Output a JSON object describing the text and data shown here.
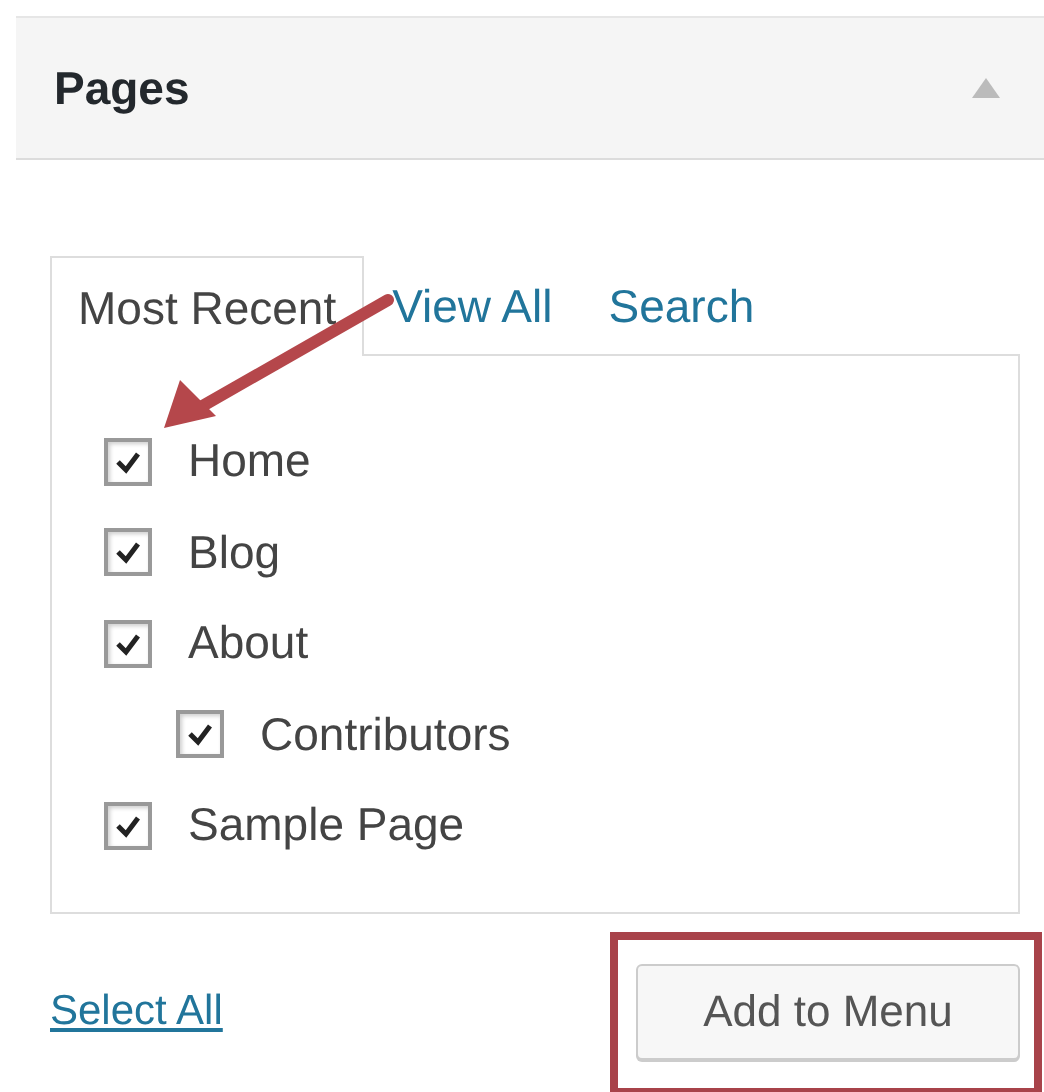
{
  "panel": {
    "title": "Pages",
    "expanded": true
  },
  "tabs": [
    {
      "label": "Most Recent",
      "selected": true
    },
    {
      "label": "View All",
      "selected": false
    },
    {
      "label": "Search",
      "selected": false
    }
  ],
  "pages": [
    {
      "label": "Home",
      "checked": true
    },
    {
      "label": "Blog",
      "checked": true
    },
    {
      "label": "About",
      "checked": true,
      "children": [
        {
          "label": "Contributors",
          "checked": true
        }
      ]
    },
    {
      "label": "Sample Page",
      "checked": true
    }
  ],
  "select_all": "Select All",
  "add_button": "Add to Menu"
}
